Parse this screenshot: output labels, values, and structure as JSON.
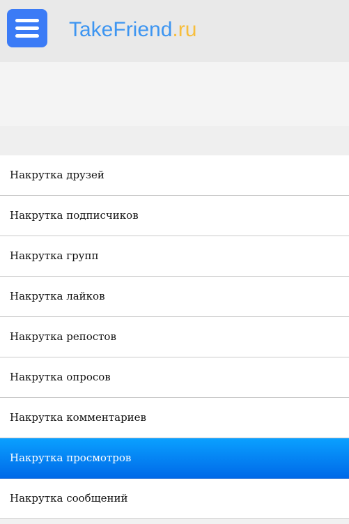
{
  "header": {
    "logo": {
      "brand": "TakeFriend",
      "tld": ".ru",
      "brand_color": "#3d95f1",
      "tld_color": "#f7be3c"
    },
    "menu_button_icon": "hamburger-icon",
    "menu_button_color": "#3b7bf6"
  },
  "menu": {
    "items": [
      {
        "label": "Накрутка друзей"
      },
      {
        "label": "Накрутка подписчиков"
      },
      {
        "label": "Накрутка групп"
      },
      {
        "label": "Накрутка лайков"
      },
      {
        "label": "Накрутка репостов"
      },
      {
        "label": "Накрутка опросов"
      },
      {
        "label": "Накрутка комментариев"
      },
      {
        "label": "Накрутка просмотров",
        "active": true
      },
      {
        "label": "Накрутка сообщений"
      }
    ],
    "active_color": "#0a8cf5"
  }
}
